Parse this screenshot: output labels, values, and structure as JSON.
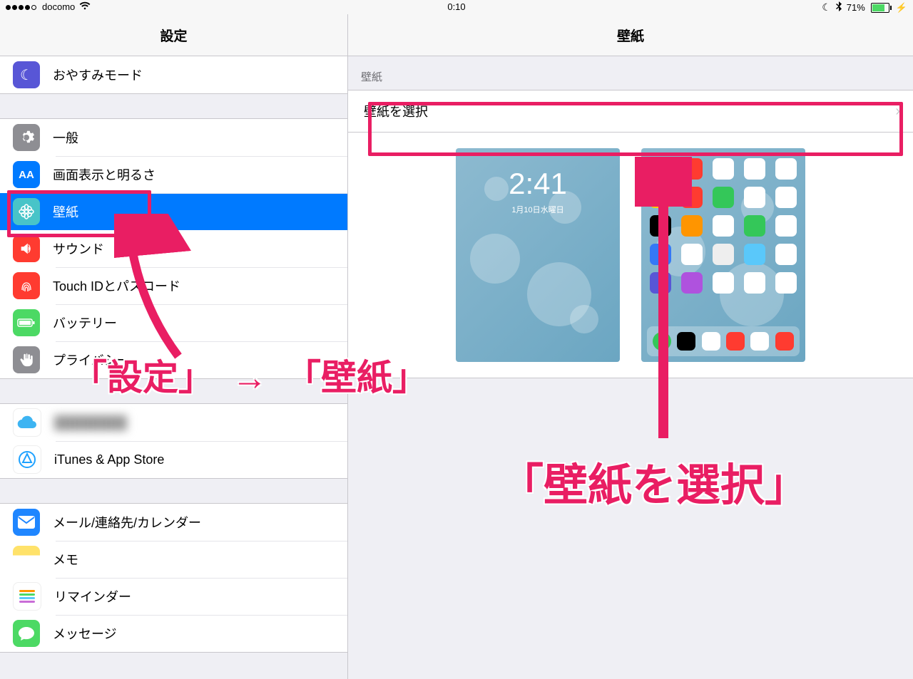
{
  "statusbar": {
    "carrier": "docomo",
    "time": "0:10",
    "battery_pct": "71%"
  },
  "sidebar": {
    "title": "設定",
    "group0": {
      "dnd": "おやすみモード"
    },
    "group1": {
      "general": "一般",
      "display": "画面表示と明るさ",
      "wallpaper": "壁紙",
      "sounds": "サウンド",
      "touchid": "Touch IDとパスコード",
      "battery": "バッテリー",
      "privacy": "プライバシー"
    },
    "group2": {
      "itunes": "iTunes & App Store"
    },
    "group3": {
      "mail": "メール/連絡先/カレンダー",
      "notes": "メモ",
      "reminders": "リマインダー",
      "messages": "メッセージ"
    }
  },
  "detail": {
    "title": "壁紙",
    "section_header": "壁紙",
    "choose": "壁紙を選択",
    "lock_time": "2:41",
    "lock_date": "1月10日水曜日"
  },
  "annotations": {
    "step1": "「設定」　→　「壁紙」",
    "step2": "「壁紙を選択」"
  }
}
